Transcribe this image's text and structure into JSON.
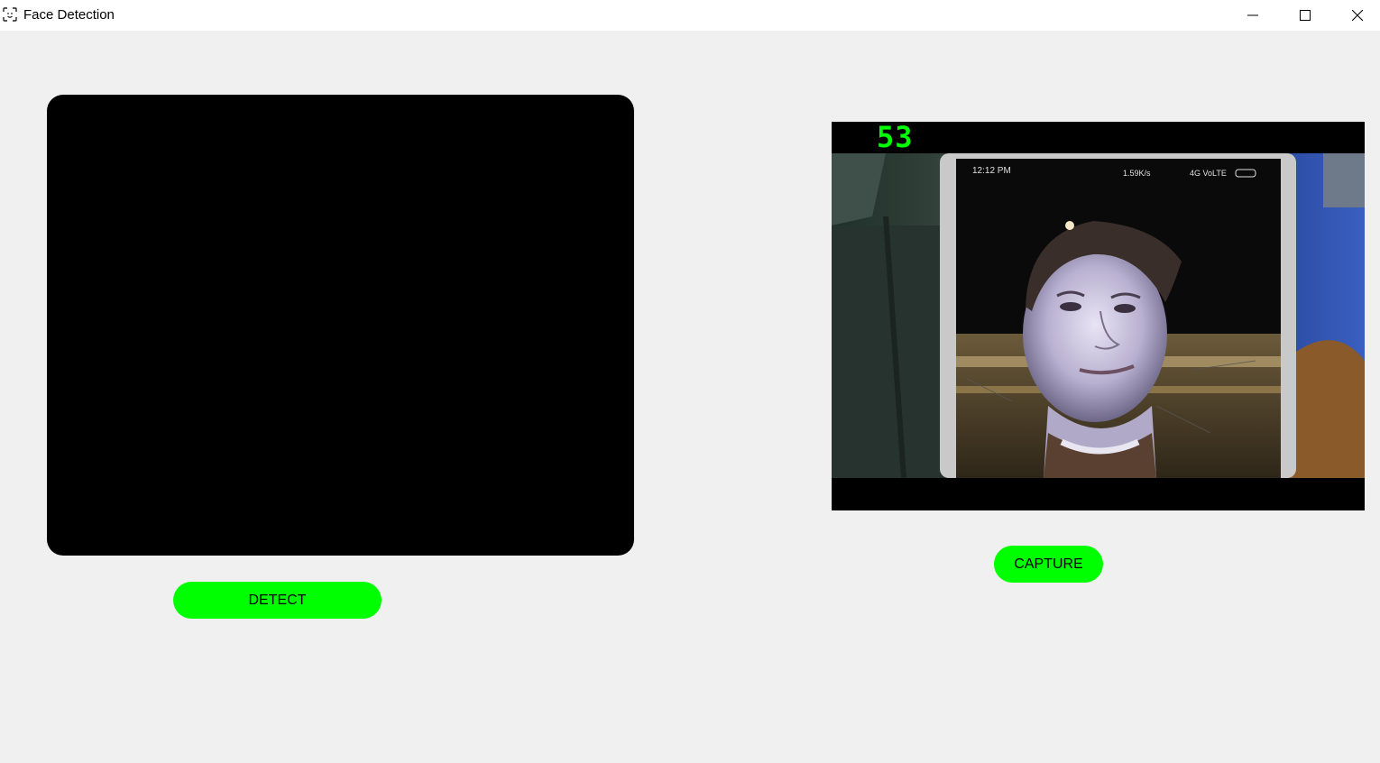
{
  "window": {
    "title": "Face Detection",
    "icon": "face-scan-icon",
    "controls": [
      "minimize-icon",
      "maximize-icon",
      "close-icon"
    ]
  },
  "left_panel": {
    "button_label": "DETECT"
  },
  "right_panel": {
    "fps_counter": "53",
    "button_label": "CAPTURE",
    "phone_status": {
      "time": "12:12 PM",
      "network": "1.59K/s",
      "signal": "4G VoLTE"
    }
  },
  "colors": {
    "accent": "#00ff00",
    "background": "#f0f0f0",
    "panel": "#000000",
    "titlebar": "#ffffff"
  }
}
